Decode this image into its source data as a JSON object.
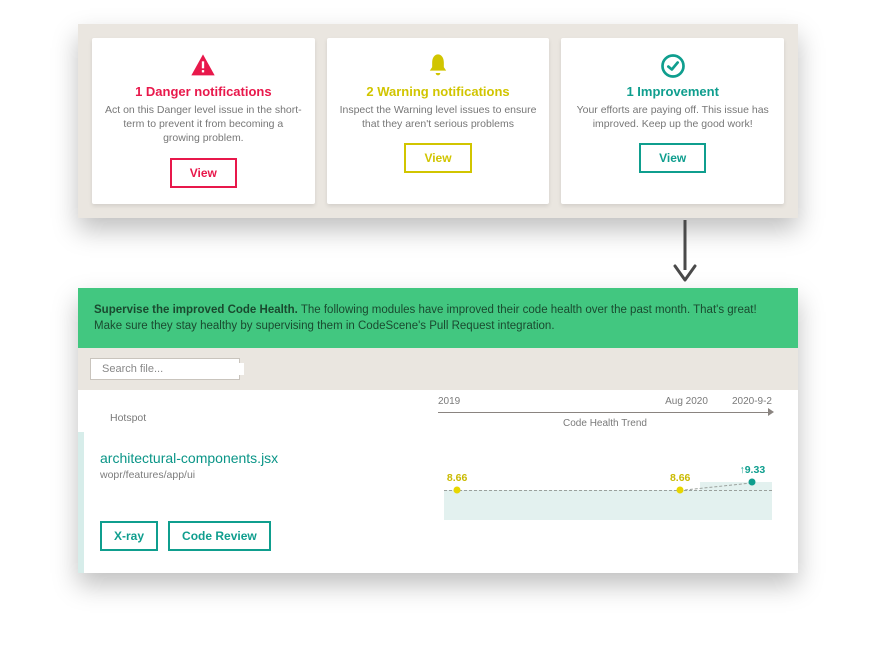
{
  "cards": {
    "danger": {
      "title": "1 Danger notifications",
      "desc": "Act on this Danger level issue in the short-term to prevent it from becoming a growing problem.",
      "button": "View"
    },
    "warning": {
      "title": "2 Warning notifications",
      "desc": "Inspect the Warning level issues to ensure that they aren't serious problems",
      "button": "View"
    },
    "improvement": {
      "title": "1 Improvement",
      "desc": "Your efforts are paying off. This issue has improved. Keep up the good work!",
      "button": "View"
    }
  },
  "banner": {
    "strong": "Supervise the improved Code Health.",
    "text": " The following modules have improved their code health over the past month. That's great! Make sure they stay healthy by supervising them in CodeScene's Pull Request integration."
  },
  "search": {
    "placeholder": "Search file..."
  },
  "hotspot": {
    "label": "Hotspot",
    "axis": {
      "start": "2019",
      "mid": "Aug 2020",
      "end": "2020-9-2",
      "trend_label": "Code Health Trend"
    },
    "file": {
      "name": "architectural-components.jsx",
      "path": "wopr/features/app/ui"
    },
    "buttons": {
      "xray": "X-ray",
      "review": "Code Review"
    }
  },
  "chart_data": {
    "type": "line",
    "title": "Code Health Trend",
    "xlabel": "",
    "ylabel": "",
    "categories": [
      "2019",
      "Aug 2020",
      "2020-9-2"
    ],
    "values": [
      8.66,
      8.66,
      9.33
    ],
    "annotations": [
      "8.66",
      "8.66",
      "↑9.33"
    ]
  }
}
